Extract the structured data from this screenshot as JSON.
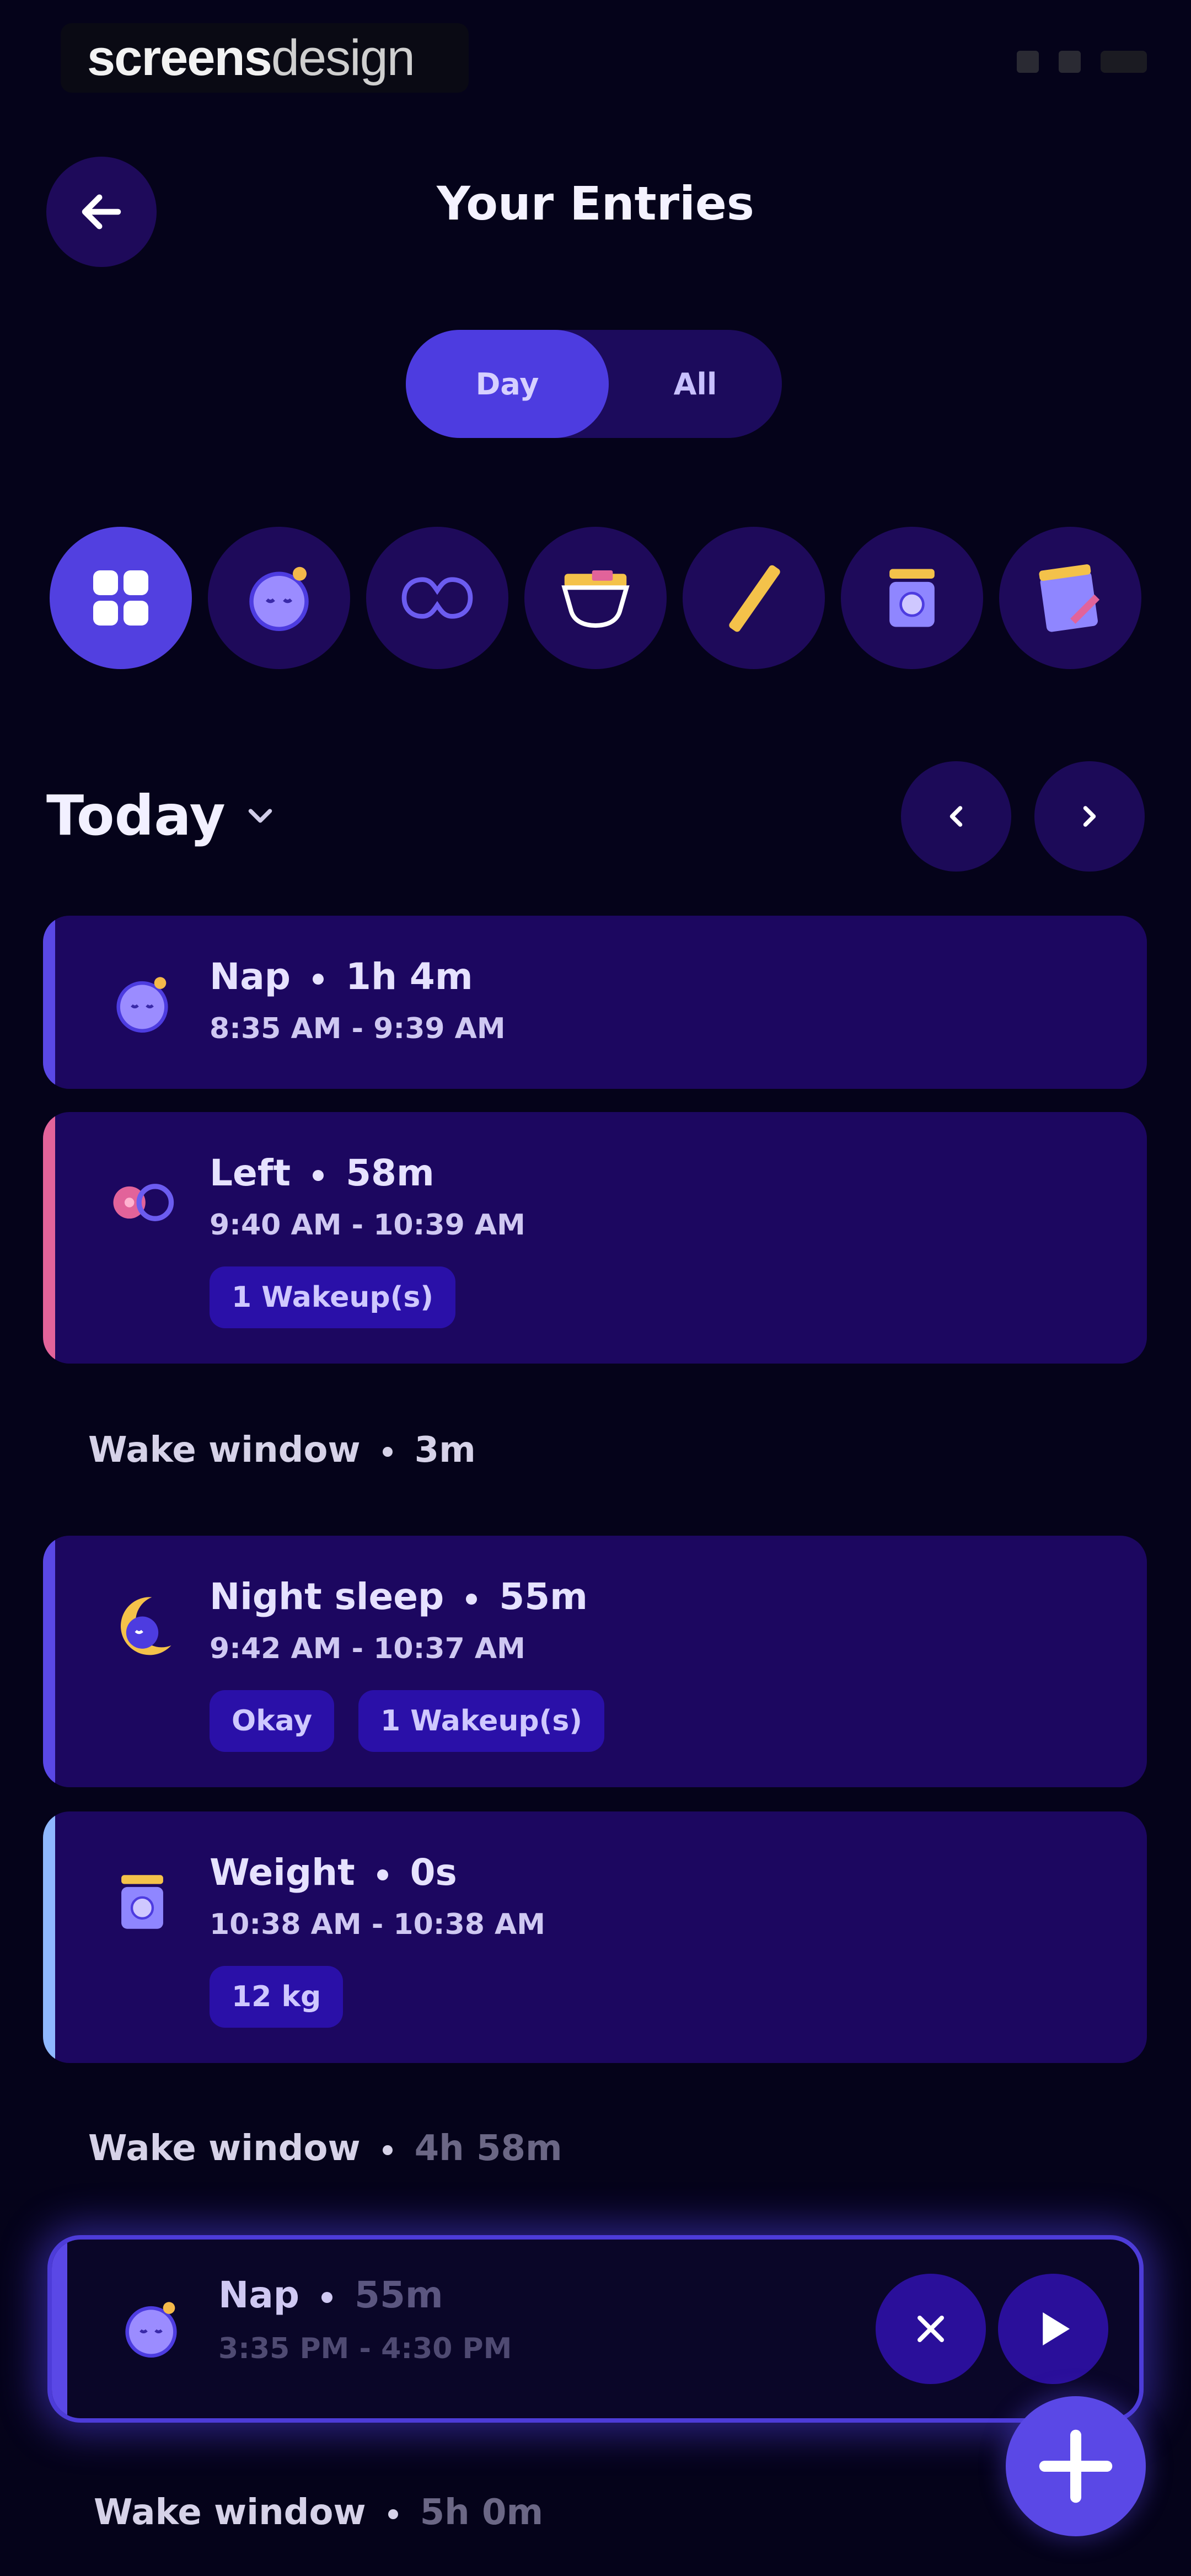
{
  "status_bar": {
    "watermark_bold": "screens",
    "watermark_light": "design"
  },
  "header": {
    "title": "Your Entries",
    "back_icon": "arrow-left-icon"
  },
  "segment": {
    "day_label": "Day",
    "all_label": "All",
    "selected": "Day"
  },
  "categories": [
    {
      "name": "all",
      "icon": "grid-icon",
      "active": true
    },
    {
      "name": "sleep",
      "icon": "moon-face-icon",
      "active": false
    },
    {
      "name": "feeding",
      "icon": "breast-icon",
      "active": false
    },
    {
      "name": "diaper",
      "icon": "diaper-icon",
      "active": false
    },
    {
      "name": "growth",
      "icon": "ruler-icon",
      "active": false
    },
    {
      "name": "weight",
      "icon": "scale-icon",
      "active": false
    },
    {
      "name": "notes",
      "icon": "notepad-icon",
      "active": false
    }
  ],
  "date": {
    "label": "Today"
  },
  "entries": [
    {
      "title": "Nap",
      "duration": "1h 4m",
      "time": "8:35 AM - 9:39 AM",
      "tags": [],
      "color": "#5a48e6"
    },
    {
      "title": "Left",
      "duration": "58m",
      "time": "9:40 AM - 10:39 AM",
      "tags": [
        "1 Wakeup(s)"
      ],
      "color": "#e2639a"
    },
    {
      "title": "Night sleep",
      "duration": "55m",
      "time": "9:42 AM - 10:37 AM",
      "tags": [
        "Okay",
        "1 Wakeup(s)"
      ],
      "color": "#5a48e6"
    },
    {
      "title": "Weight",
      "duration": "0s",
      "time": "10:38 AM - 10:38 AM",
      "tags": [
        "12 kg"
      ],
      "color": "#8fb8ff"
    }
  ],
  "wake_windows": [
    {
      "label": "Wake window",
      "value": "3m"
    },
    {
      "label": "Wake window",
      "value": "4h 58m"
    },
    {
      "label": "Wake window",
      "value": "5h 0m"
    }
  ],
  "active_entry": {
    "title": "Nap",
    "duration": "55m",
    "time": "3:35 PM - 4:30 PM"
  }
}
